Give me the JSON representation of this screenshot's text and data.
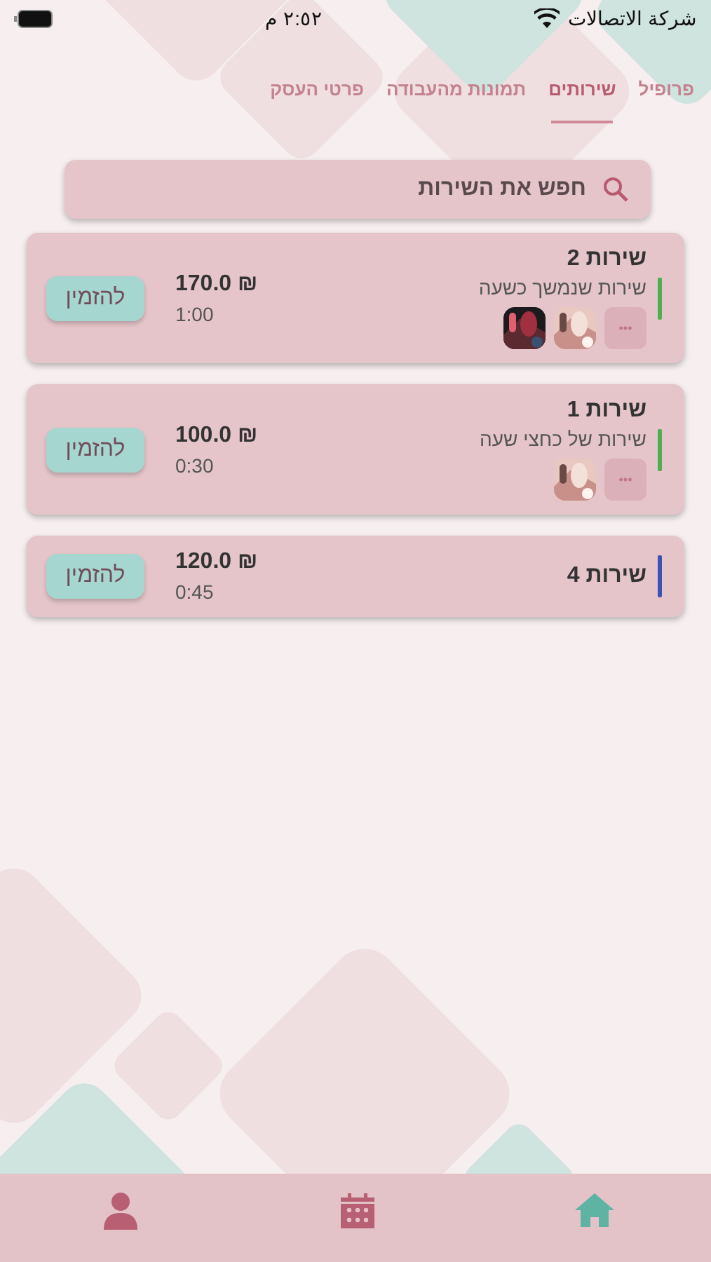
{
  "status_bar": {
    "carrier": "شركة الاتصالات",
    "time": "٢:٥٢ م"
  },
  "tabs": [
    {
      "label": "פרופיל",
      "selected": false
    },
    {
      "label": "שירותים",
      "selected": true
    },
    {
      "label": "תמונות מהעבודה",
      "selected": false
    },
    {
      "label": "פרטי העסק",
      "selected": false
    }
  ],
  "search": {
    "placeholder": "חפש את השירות"
  },
  "services": [
    {
      "name": "שירות 2",
      "description": "שירות שנמשך כשעה",
      "color": "#4caf50",
      "more": "•••",
      "price": "170.0 ₪",
      "duration": "1:00",
      "book": "להזמין"
    },
    {
      "name": "שירות 1",
      "description": "שירות של כחצי שעה",
      "color": "#4caf50",
      "more": "•••",
      "price": "100.0 ₪",
      "duration": "0:30",
      "book": "להזמין"
    },
    {
      "name": "שירות 4",
      "color": "#3f51b5",
      "price": "120.0 ₪",
      "duration": "0:45",
      "book": "להזמין"
    }
  ],
  "nav": [
    {
      "kind": "home",
      "selected": true
    },
    {
      "kind": "calendar",
      "selected": false
    },
    {
      "kind": "person",
      "selected": false
    }
  ]
}
